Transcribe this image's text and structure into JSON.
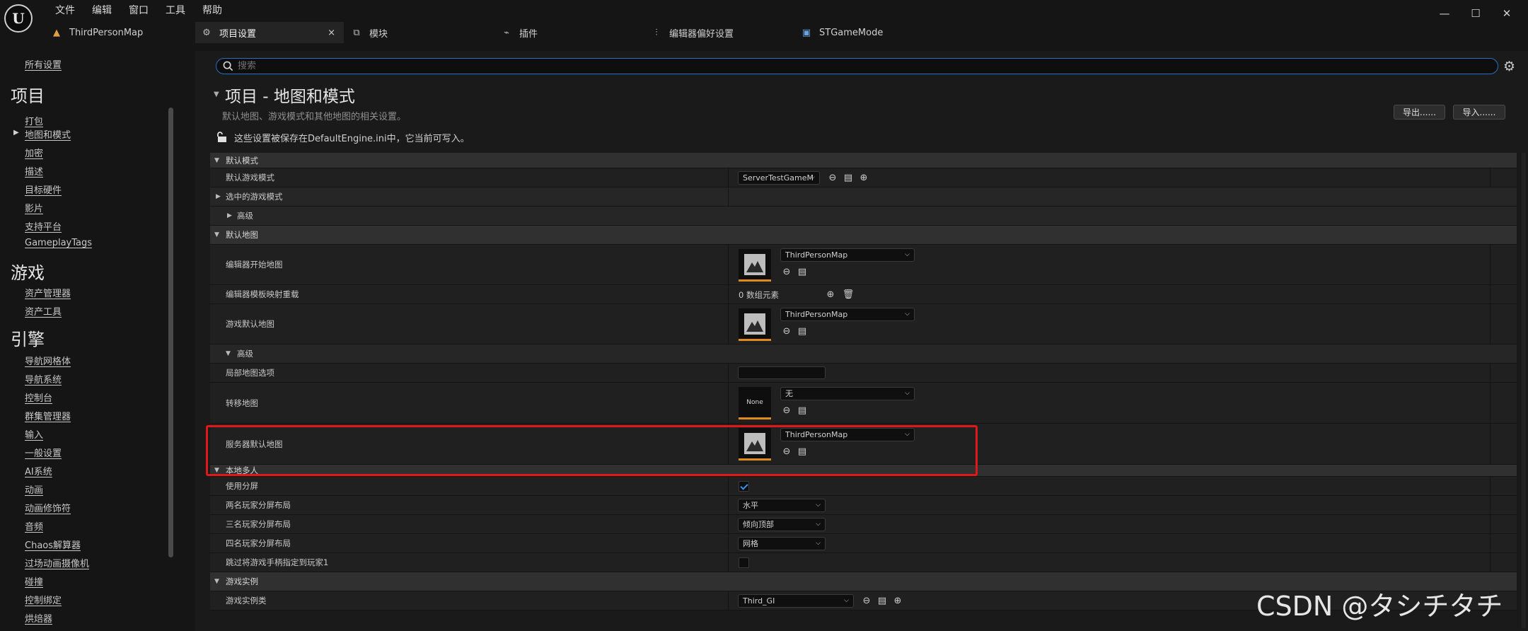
{
  "menu": [
    "文件",
    "编辑",
    "窗口",
    "工具",
    "帮助"
  ],
  "window_controls": {
    "minimize": "—",
    "maximize": "☐",
    "close": "✕"
  },
  "tabs": [
    {
      "label": "ThirdPersonMap",
      "icon": "map-icon",
      "active": false
    },
    {
      "label": "项目设置",
      "icon": "settings-icon",
      "active": true
    },
    {
      "label": "模块",
      "icon": "module-icon",
      "active": false
    },
    {
      "label": "插件",
      "icon": "plugin-icon",
      "active": false
    },
    {
      "label": "编辑器偏好设置",
      "icon": "sliders-icon",
      "active": false
    },
    {
      "label": "STGameMode",
      "icon": "blueprint-icon",
      "active": false
    }
  ],
  "tab_close": "×",
  "sidebar": {
    "all_settings": "所有设置",
    "sections": [
      {
        "title": "项目",
        "items": [
          "打包",
          "地图和模式",
          "加密",
          "描述",
          "目标硬件",
          "影片",
          "支持平台",
          "GameplayTags"
        ]
      },
      {
        "title": "游戏",
        "items": [
          "资产管理器",
          "资产工具"
        ]
      },
      {
        "title": "引擎",
        "items": [
          "导航网格体",
          "导航系统",
          "控制台",
          "群集管理器",
          "输入",
          "一般设置",
          "AI系统",
          "动画",
          "动画修饰符",
          "音频",
          "Chaos解算器",
          "过场动画摄像机",
          "碰撞",
          "控制绑定",
          "烘焙器"
        ]
      }
    ]
  },
  "search": {
    "placeholder": "搜索"
  },
  "header": {
    "title": "项目 - 地图和模式",
    "description": "默认地图、游戏模式和其他地图的相关设置。",
    "lock_note": "这些设置被保存在DefaultEngine.ini中，它当前可写入。",
    "export_label": "导出......",
    "import_label": "导入......"
  },
  "props": {
    "cat_default_modes": "默认模式",
    "default_game_mode": "默认游戏模式",
    "default_game_mode_value": "ServerTestGameM",
    "selected_game_mode": "选中的游戏模式",
    "advanced": "高级",
    "cat_default_maps": "默认地图",
    "editor_startup_map": "编辑器开始地图",
    "editor_startup_map_value": "ThirdPersonMap",
    "editor_template_map_overrides": "编辑器模板映射重载",
    "array_elements": "0 数组元素",
    "game_default_map": "游戏默认地图",
    "game_default_map_value": "ThirdPersonMap",
    "advanced2": "高级",
    "local_map_options": "局部地图选项",
    "transition_map": "转移地图",
    "transition_map_thumb": "None",
    "transition_map_value": "无",
    "server_default_map": "服务器默认地图",
    "server_default_map_value": "ThirdPersonMap",
    "cat_local_multiplayer": "本地多人",
    "use_splitscreen": "使用分屏",
    "use_splitscreen_checked": true,
    "two_player_layout": "两名玩家分屏布局",
    "two_player_layout_value": "水平",
    "three_player_layout": "三名玩家分屏布局",
    "three_player_layout_value": "倾向顶部",
    "four_player_layout": "四名玩家分屏布局",
    "four_player_layout_value": "网格",
    "skip_gamepad": "跳过将游戏手柄指定到玩家1",
    "skip_gamepad_checked": false,
    "cat_game_instance": "游戏实例",
    "game_instance_class": "游戏实例类",
    "game_instance_class_value": "Third_GI"
  },
  "watermark": "CSDN @タシチタチ",
  "colors": {
    "accent": "#2a6fc0",
    "highlight": "#e01818",
    "thumb_border": "#e08a1e",
    "check": "#3a8ef0"
  }
}
